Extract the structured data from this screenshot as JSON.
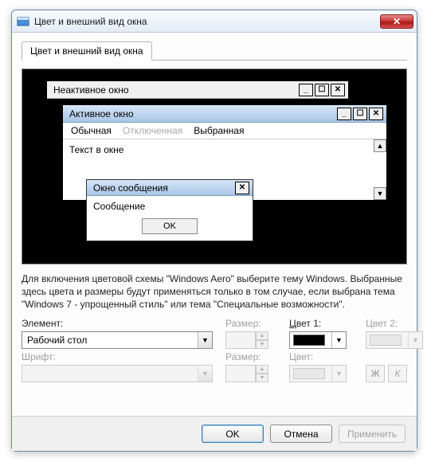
{
  "window": {
    "title": "Цвет и внешний вид окна",
    "close_glyph": "✕"
  },
  "tab": {
    "label": "Цвет и внешний вид окна"
  },
  "preview": {
    "inactive_title": "Неактивное окно",
    "active_title": "Активное окно",
    "menu": {
      "normal": "Обычная",
      "disabled": "Отключенная",
      "selected": "Выбранная"
    },
    "window_text": "Текст в окне",
    "msg_title": "Окно сообщения",
    "msg_text": "Сообщение",
    "msg_ok": "OK",
    "wbtn": {
      "min": "_",
      "max": "☐",
      "close": "✕"
    },
    "scroll": {
      "up": "▲",
      "down": "▼"
    }
  },
  "description": "Для включения цветовой схемы \"Windows Aero\" выберите тему Windows. Выбранные здесь цвета и размеры будут применяться только в том случае, если выбрана тема \"Windows 7 - упрощенный стиль\" или тема \"Специальные возможности\".",
  "labels": {
    "element": "Элемент:",
    "size": "Размер:",
    "color1": "Цвет 1:",
    "color2": "Цвет 2:",
    "font": "Шрифт:",
    "fsize": "Размер:",
    "fcolor": "Цвет:"
  },
  "element_combo": {
    "value": "Рабочий стол"
  },
  "color1": "#000000",
  "style": {
    "bold": "Ж",
    "italic": "К"
  },
  "buttons": {
    "ok": "OK",
    "cancel": "Отмена",
    "apply": "Применить"
  }
}
